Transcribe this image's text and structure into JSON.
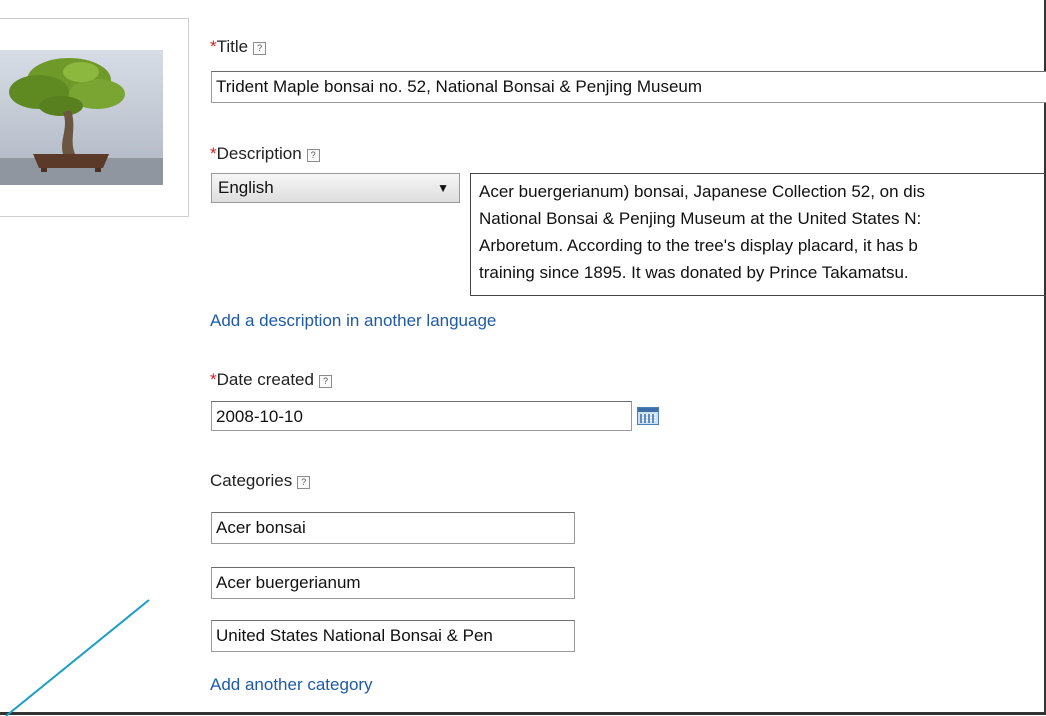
{
  "title_field": {
    "required_mark": "*",
    "label": "Title",
    "help": "?",
    "value": "Trident Maple bonsai no. 52, National Bonsai & Penjing Museum"
  },
  "description_field": {
    "required_mark": "*",
    "label": "Description",
    "help": "?",
    "language": "English",
    "lines": [
      "Acer buergerianum) bonsai, Japanese Collection 52, on dis",
      "National Bonsai & Penjing Museum at the United States N:",
      "Arboretum. According to the tree's display placard, it has b",
      "training since 1895. It was donated by Prince Takamatsu."
    ]
  },
  "add_description_link": "Add a description in another language",
  "date_field": {
    "required_mark": "*",
    "label": "Date created",
    "help": "?",
    "value": "2008-10-10",
    "icon": "calendar-icon"
  },
  "categories_field": {
    "label": "Categories",
    "help": "?",
    "items": [
      "Acer bonsai",
      "Acer buergerianum",
      "United States National Bonsai & Pen"
    ]
  },
  "add_category_link": "Add another category",
  "colors": {
    "link": "#1f5aa6",
    "required": "#d21f1f",
    "accent_line": "#1a9ec9"
  }
}
